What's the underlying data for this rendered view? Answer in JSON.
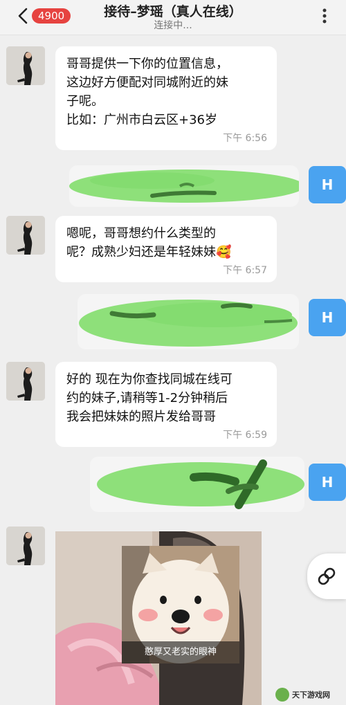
{
  "header": {
    "badge_count": "4900",
    "title": "接待–梦瑶（真人在线）",
    "status": "连接中..."
  },
  "messages": [
    {
      "text": "哥哥提供一下你的位置信息，\n这边好方便配对同城附近的妹\n子呢。\n比如：广州市白云区+36岁",
      "time": "下午 6:56"
    },
    {
      "text": "嗯呢，哥哥想约什么类型的\n呢？成熟少妇还是年轻妹妹🥰",
      "time": "下午 6:57"
    },
    {
      "text": "好的 现在为你查找同城在线可\n约的妹子,请稍等1-2分钟稍后\n我会把妹妹的照片发给哥哥",
      "time": "下午 6:59"
    }
  ],
  "self_avatar_letter": "H",
  "meme_caption": "憨厚又老实的眼神",
  "watermark_text": "天下游戏网",
  "colors": {
    "badge": "#e64340",
    "self_avatar": "#4aa3f0",
    "redaction": "#8ee07a"
  }
}
